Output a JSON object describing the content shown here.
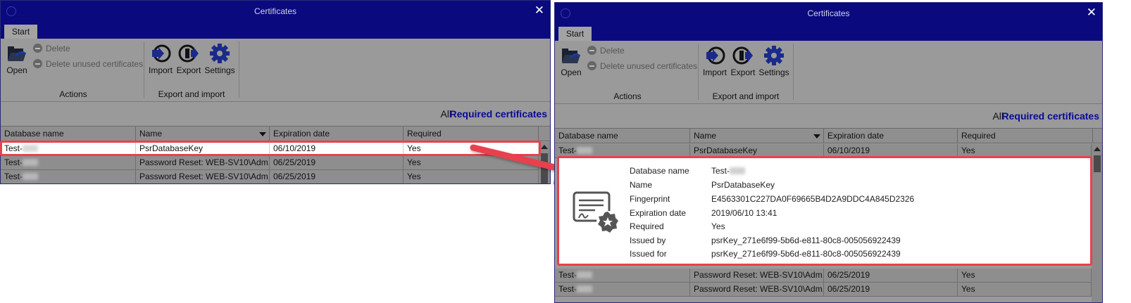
{
  "window": {
    "title": "Certificates",
    "close_glyph": "✕",
    "tab": "Start"
  },
  "ribbon": {
    "open": "Open",
    "delete": "Delete",
    "delete_unused": "Delete unused certificates",
    "actions_group": "Actions",
    "import": "Import",
    "export": "Export",
    "settings": "Settings",
    "export_import_group": "Export and import"
  },
  "filter": {
    "all": "All",
    "required": "Required certificates"
  },
  "columns": [
    "Database name",
    "Name",
    "Expiration date",
    "Required"
  ],
  "rows": [
    {
      "db": "Test-",
      "name": "PsrDatabaseKey",
      "expires": "06/10/2019",
      "required": "Yes"
    },
    {
      "db": "Test-",
      "name": "Password Reset: WEB-SV10\\Adm...",
      "expires": "06/25/2019",
      "required": "Yes"
    },
    {
      "db": "Test-",
      "name": "Password Reset: WEB-SV10\\Adm...",
      "expires": "06/25/2019",
      "required": "Yes"
    }
  ],
  "details": {
    "labels": {
      "database_name": "Database name",
      "name": "Name",
      "fingerprint": "Fingerprint",
      "expiration_date": "Expiration date",
      "required": "Required",
      "issued_by": "Issued by",
      "issued_for": "Issued for"
    },
    "values": {
      "database_name": "Test-",
      "name": "PsrDatabaseKey",
      "fingerprint": "E4563301C227DA0F69665B4D2A9DDC4A845D2326",
      "expiration_date": "2019/06/10 13:41",
      "required": "Yes",
      "issued_by": "psrKey_271e6f99-5b6d-e811-80c8-005056922439",
      "issued_for": "psrKey_271e6f99-5b6d-e811-80c8-005056922439"
    }
  },
  "colors": {
    "titlebar": "#0a0a7e",
    "highlight": "#e8414e",
    "required_link": "#0a0a9a",
    "gear": "#1a2a8a"
  }
}
